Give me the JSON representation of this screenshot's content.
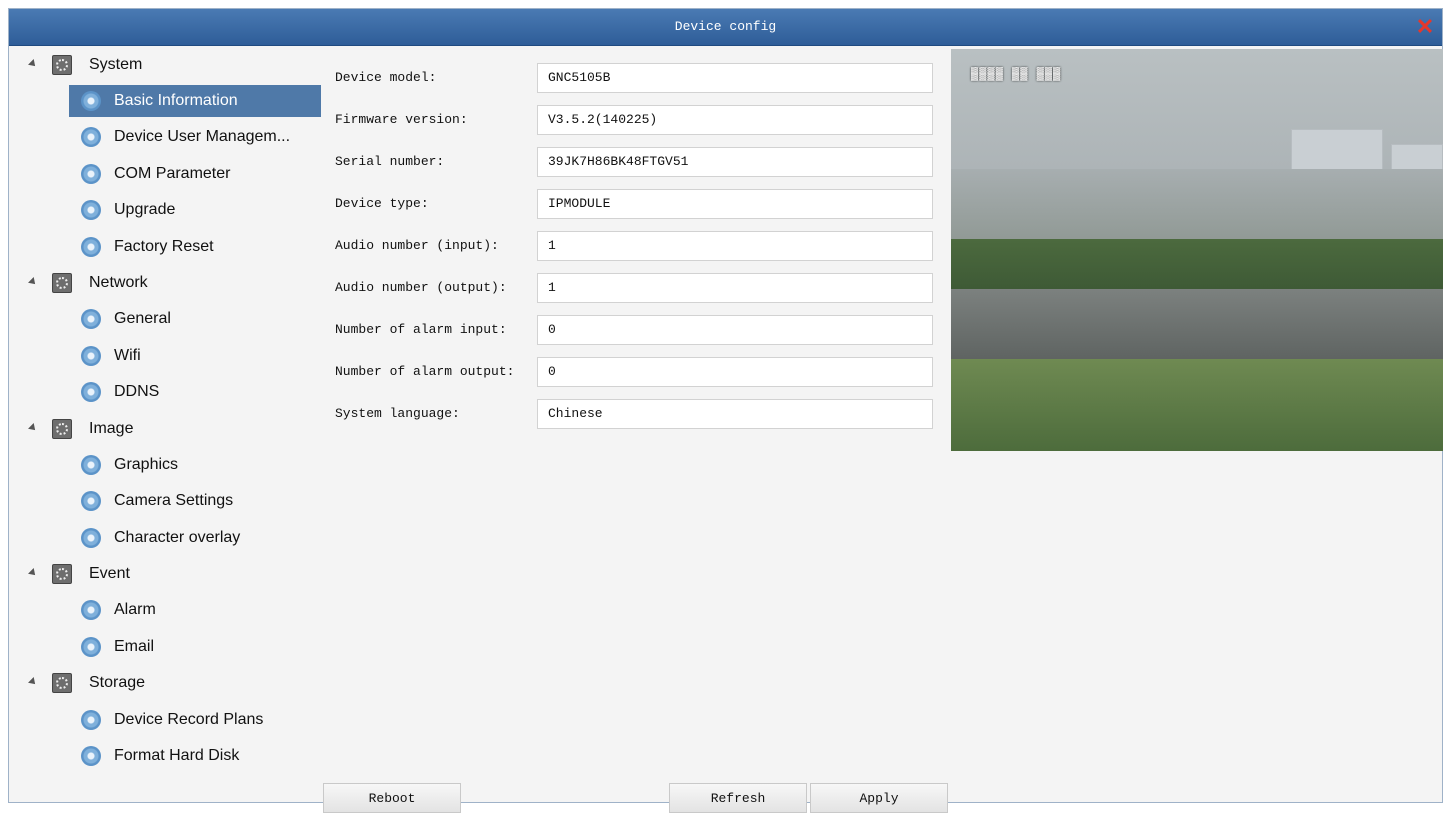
{
  "window": {
    "title": "Device config"
  },
  "tree": {
    "categories": [
      {
        "label": "System",
        "items": [
          "Basic Information",
          "Device User Managem...",
          "COM Parameter",
          "Upgrade",
          "Factory Reset"
        ]
      },
      {
        "label": "Network",
        "items": [
          "General",
          "Wifi",
          "DDNS"
        ]
      },
      {
        "label": "Image",
        "items": [
          "Graphics",
          "Camera Settings",
          "Character overlay"
        ]
      },
      {
        "label": "Event",
        "items": [
          "Alarm",
          "Email"
        ]
      },
      {
        "label": "Storage",
        "items": [
          "Device Record Plans",
          "Format Hard Disk"
        ]
      }
    ],
    "selected": "Basic Information"
  },
  "form": {
    "fields": [
      {
        "label": "Device model:",
        "value": "GNC5105B"
      },
      {
        "label": "Firmware version:",
        "value": "V3.5.2(140225)"
      },
      {
        "label": "Serial number:",
        "value": "39JK7H86BK48FTGV51"
      },
      {
        "label": "Device type:",
        "value": "IPMODULE"
      },
      {
        "label": "Audio number (input):",
        "value": "1"
      },
      {
        "label": "Audio number (output):",
        "value": "1"
      },
      {
        "label": "Number of alarm input:",
        "value": "0"
      },
      {
        "label": "Number of alarm output:",
        "value": "0"
      },
      {
        "label": "System language:",
        "value": "Chinese"
      }
    ]
  },
  "buttons": {
    "reboot": "Reboot",
    "refresh": "Refresh",
    "apply": "Apply"
  }
}
